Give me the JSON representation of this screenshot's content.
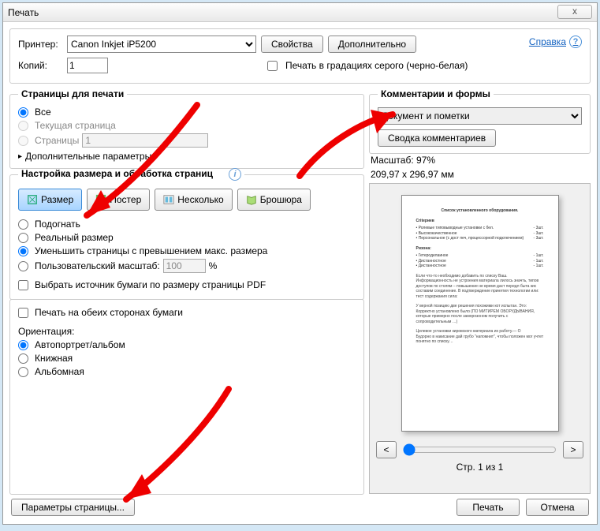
{
  "window": {
    "title": "Печать",
    "close_glyph": "x"
  },
  "top": {
    "printer_label": "Принтер:",
    "printer_value": "Canon Inkjet iP5200",
    "properties_btn": "Свойства",
    "advanced_btn": "Дополнительно",
    "help_link": "Справка",
    "help_glyph": "?",
    "copies_label": "Копий:",
    "copies_value": "1",
    "grayscale_label": "Печать в градациях серого (черно-белая)"
  },
  "pages": {
    "legend": "Страницы для печати",
    "all": "Все",
    "current": "Текущая страница",
    "range_label": "Страницы",
    "range_value": "1",
    "more_params": "Дополнительные параметры",
    "tri": "▸"
  },
  "size": {
    "legend": "Настройка размера и обработка страниц",
    "info_glyph": "i",
    "tab_size": "Размер",
    "tab_poster": "Постер",
    "tab_multiple": "Несколько",
    "tab_booklet": "Брошюра",
    "fit": "Подогнать",
    "actual": "Реальный размер",
    "shrink": "Уменьшить страницы с превышением макс. размера",
    "custom": "Пользовательский масштаб:",
    "custom_value": "100",
    "custom_unit": "%",
    "source_by_pdf": "Выбрать источник бумаги по размеру страницы PDF"
  },
  "duplex": {
    "both_sides": "Печать на обеих сторонах бумаги",
    "orientation_label": "Ориентация:",
    "auto": "Автопортрет/альбом",
    "portrait": "Книжная",
    "landscape": "Альбомная"
  },
  "comments": {
    "legend": "Комментарии и формы",
    "select_value": "Документ и пометки",
    "summary_btn": "Сводка комментариев"
  },
  "preview": {
    "scale_label": "Масштаб:",
    "scale_value": "97%",
    "dims": "209,97 x 296,97 мм",
    "page_indicator": "Стр. 1 из 1",
    "prev_glyph": "<",
    "next_glyph": ">",
    "doc_title": "Список установленного оборудования."
  },
  "bottom": {
    "page_setup": "Параметры страницы...",
    "print": "Печать",
    "cancel": "Отмена"
  }
}
